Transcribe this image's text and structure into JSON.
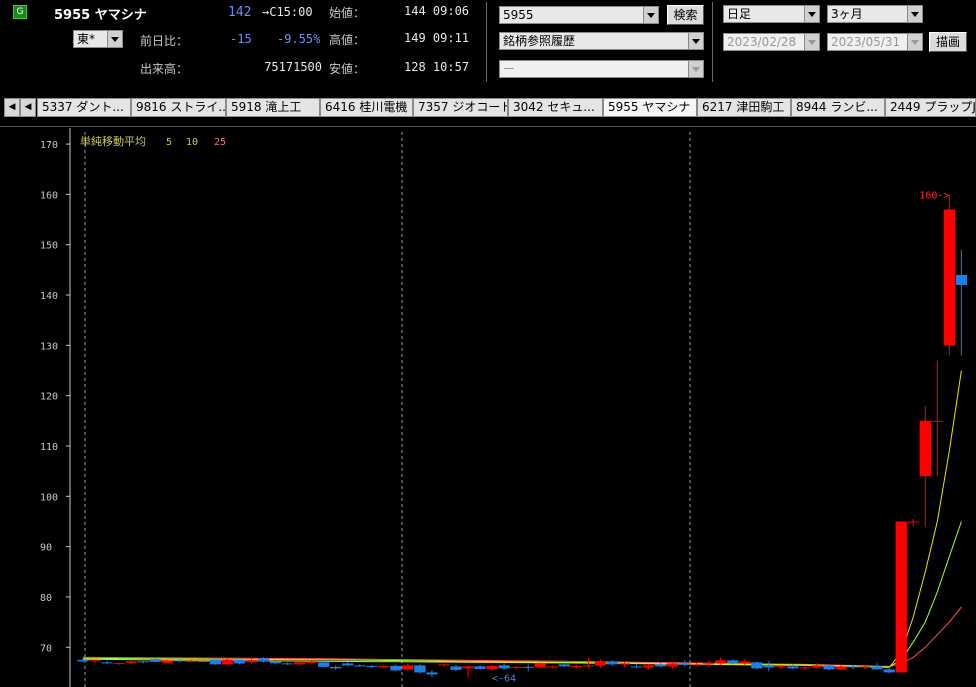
{
  "header": {
    "market_badge": "G",
    "stock_title": "5955 ヤマシナ",
    "price": "142",
    "price_time": "→C15:00",
    "exchange_value": "東*",
    "prev_diff_label": "前日比：",
    "prev_diff": "-15",
    "prev_diff_pct": "-9.55%",
    "volume_label": "出来高：",
    "volume": "75171500",
    "open_label": "始値：",
    "open_value": "144 09:06",
    "high_label": "高値：",
    "high_value": "149 09:11",
    "low_label": "安値：",
    "low_value": "128 10:57"
  },
  "search": {
    "code_value": "5955",
    "search_button": "検索",
    "history_value": "銘柄参照履歴",
    "third_value": "ー"
  },
  "period": {
    "interval_value": "日足",
    "range_value": "3ヶ月",
    "start_date": "2023/02/28",
    "end_date": "2023/05/31",
    "draw_button": "描画"
  },
  "tabs": [
    {
      "label": "5337 ダント..."
    },
    {
      "label": "9816 ストライ..."
    },
    {
      "label": "5918 滝上工"
    },
    {
      "label": "6416 桂川電機"
    },
    {
      "label": "7357 ジオコード"
    },
    {
      "label": "3042 セキュ..."
    },
    {
      "label": "5955 ヤマシナ"
    },
    {
      "label": "6217 津田駒工"
    },
    {
      "label": "8944 ランビ..."
    },
    {
      "label": "2449 プラップJ"
    }
  ],
  "nav": {
    "first_icon": "skip-start-icon",
    "prev_icon": "prev-icon"
  },
  "colors": {
    "up": "#ff0000",
    "down": "#1e7fe8",
    "ma5": "#e6e600",
    "ma10": "#a0ff40",
    "ma25": "#ff5050",
    "axis": "#c8c8c8"
  },
  "chart_data": {
    "type": "candlestick",
    "title": "",
    "legend_label": "単純移動平均",
    "ma_periods": [
      "5",
      "10",
      "25"
    ],
    "y_ticks": [
      70,
      80,
      90,
      100,
      110,
      120,
      130,
      140,
      150,
      160,
      170
    ],
    "ylim": [
      62.5,
      172
    ],
    "annotation_high": "160->",
    "annotation_low": "<-64",
    "candles": [
      [
        67.5,
        67.8,
        67.0,
        67.2
      ],
      [
        67.2,
        67.5,
        66.8,
        67.4
      ],
      [
        67.0,
        67.3,
        66.6,
        66.8
      ],
      [
        66.8,
        67.0,
        66.5,
        66.9
      ],
      [
        66.9,
        67.3,
        66.8,
        67.2
      ],
      [
        67.2,
        67.6,
        66.8,
        67.0
      ],
      [
        67.6,
        67.8,
        67.0,
        67.1
      ],
      [
        66.9,
        67.5,
        66.9,
        67.4
      ],
      [
        67.4,
        67.6,
        67.0,
        67.2
      ],
      [
        67.2,
        67.5,
        67.0,
        67.3
      ],
      [
        67.3,
        67.6,
        67.0,
        67.1
      ],
      [
        67.5,
        67.6,
        66.5,
        66.6
      ],
      [
        66.6,
        67.8,
        66.4,
        67.5
      ],
      [
        67.5,
        67.6,
        66.6,
        66.8
      ],
      [
        67.0,
        67.8,
        66.8,
        67.4
      ],
      [
        67.8,
        68.0,
        67.0,
        67.2
      ],
      [
        67.2,
        67.4,
        66.6,
        66.8
      ],
      [
        66.8,
        67.0,
        66.5,
        66.6
      ],
      [
        66.6,
        67.2,
        66.5,
        67.0
      ],
      [
        66.9,
        67.3,
        66.8,
        67.2
      ],
      [
        67.0,
        67.2,
        66.0,
        66.1
      ],
      [
        66.1,
        66.4,
        65.5,
        65.8
      ],
      [
        66.8,
        67.1,
        66.2,
        66.4
      ],
      [
        66.4,
        66.6,
        66.1,
        66.3
      ],
      [
        66.3,
        66.5,
        65.8,
        66.2
      ],
      [
        66.2,
        66.4,
        66.0,
        66.3
      ],
      [
        66.3,
        66.6,
        65.2,
        65.4
      ],
      [
        65.6,
        66.8,
        65.3,
        66.4
      ],
      [
        66.4,
        66.6,
        64.8,
        65.0
      ],
      [
        65.0,
        65.5,
        64.0,
        64.6
      ],
      [
        66.4,
        66.7,
        66.1,
        66.6
      ],
      [
        66.2,
        66.5,
        65.3,
        65.5
      ],
      [
        65.8,
        66.4,
        64.0,
        66.2
      ],
      [
        66.2,
        66.5,
        65.6,
        65.7
      ],
      [
        65.7,
        66.4,
        65.4,
        66.3
      ],
      [
        66.4,
        66.8,
        65.6,
        65.8
      ],
      [
        66.0,
        66.3,
        65.6,
        66.1
      ],
      [
        66.1,
        66.6,
        65.2,
        66.0
      ],
      [
        66.0,
        67.0,
        65.8,
        66.8
      ],
      [
        66.2,
        66.4,
        65.8,
        66.2
      ],
      [
        66.6,
        67.0,
        66.0,
        66.2
      ],
      [
        66.2,
        66.5,
        65.8,
        66.3
      ],
      [
        66.2,
        68.0,
        66.0,
        66.4
      ],
      [
        66.4,
        67.6,
        66.0,
        67.2
      ],
      [
        67.2,
        67.4,
        66.4,
        66.6
      ],
      [
        66.6,
        67.0,
        66.0,
        66.8
      ],
      [
        66.2,
        66.6,
        65.8,
        66.0
      ],
      [
        66.0,
        66.6,
        65.6,
        66.4
      ],
      [
        66.6,
        67.0,
        66.0,
        66.2
      ],
      [
        66.2,
        66.9,
        65.7,
        66.8
      ],
      [
        66.8,
        67.4,
        66.2,
        66.5
      ],
      [
        66.4,
        67.0,
        66.2,
        66.6
      ],
      [
        66.6,
        67.4,
        66.2,
        66.8
      ],
      [
        66.8,
        68.0,
        66.5,
        67.4
      ],
      [
        67.4,
        67.6,
        66.6,
        66.8
      ],
      [
        66.8,
        67.6,
        66.5,
        67.2
      ],
      [
        67.0,
        67.2,
        65.6,
        65.8
      ],
      [
        66.5,
        67.2,
        65.2,
        66.0
      ],
      [
        66.0,
        66.4,
        65.6,
        66.2
      ],
      [
        66.2,
        66.6,
        65.6,
        65.8
      ],
      [
        65.8,
        66.2,
        65.5,
        66.0
      ],
      [
        66.0,
        66.8,
        65.7,
        66.4
      ],
      [
        66.4,
        66.6,
        65.4,
        65.6
      ],
      [
        65.6,
        66.4,
        65.5,
        66.2
      ],
      [
        66.2,
        66.4,
        65.6,
        66.0
      ],
      [
        66.0,
        66.4,
        65.7,
        66.2
      ],
      [
        66.2,
        66.8,
        65.6,
        65.6
      ],
      [
        65.6,
        66.2,
        64.8,
        65.0
      ],
      [
        65.0,
        95.0,
        65.0,
        95.0
      ],
      [
        95.0,
        95.5,
        94.0,
        95.0
      ],
      [
        104.0,
        118.0,
        94.0,
        115.0
      ],
      [
        115.0,
        127.0,
        104.0,
        115.0
      ],
      [
        130.0,
        160.0,
        128.0,
        157.0
      ],
      [
        144.0,
        149.0,
        128.0,
        142.0
      ]
    ],
    "ma5": [
      [
        0,
        67.6
      ],
      [
        20,
        67.2
      ],
      [
        40,
        66.9
      ],
      [
        60,
        66.4
      ],
      [
        67,
        66.0
      ],
      [
        68,
        69
      ],
      [
        69,
        76
      ],
      [
        70,
        85
      ],
      [
        71,
        95
      ],
      [
        72,
        109
      ],
      [
        73,
        125
      ]
    ],
    "ma10": [
      [
        0,
        67.8
      ],
      [
        20,
        67.5
      ],
      [
        40,
        67.0
      ],
      [
        60,
        66.5
      ],
      [
        67,
        66.1
      ],
      [
        68,
        67.5
      ],
      [
        69,
        71
      ],
      [
        70,
        75
      ],
      [
        71,
        81
      ],
      [
        72,
        88
      ],
      [
        73,
        95
      ]
    ],
    "ma25": [
      [
        0,
        68.0
      ],
      [
        20,
        67.7
      ],
      [
        40,
        67.2
      ],
      [
        60,
        66.6
      ],
      [
        67,
        66.2
      ],
      [
        68,
        66.8
      ],
      [
        69,
        68
      ],
      [
        70,
        70
      ],
      [
        71,
        72.5
      ],
      [
        72,
        75
      ],
      [
        73,
        78
      ]
    ]
  }
}
